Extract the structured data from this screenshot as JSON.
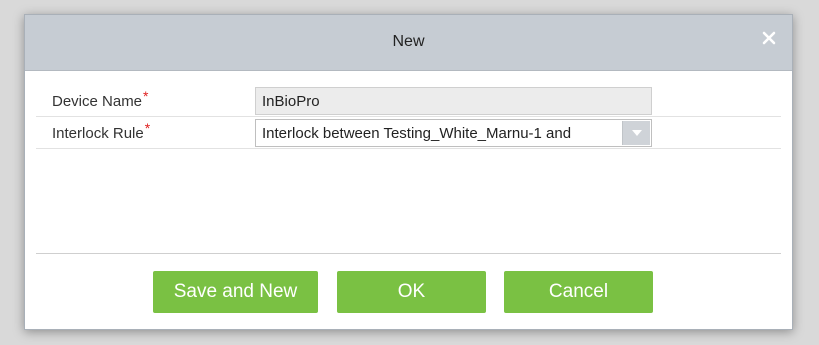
{
  "dialog": {
    "title": "New",
    "close_icon": "close-icon"
  },
  "form": {
    "device_name": {
      "label": "Device Name",
      "required_mark": "*",
      "value": "InBioPro"
    },
    "interlock_rule": {
      "label": "Interlock Rule",
      "required_mark": "*",
      "value": "Interlock between Testing_White_Marnu-1 and",
      "dropdown_icon": "chevron-down-icon"
    }
  },
  "buttons": {
    "save_and_new": "Save and New",
    "ok": "OK",
    "cancel": "Cancel"
  },
  "colors": {
    "accent_button": "#7ac143",
    "titlebar": "#c6ccd3",
    "required": "#e02020"
  }
}
